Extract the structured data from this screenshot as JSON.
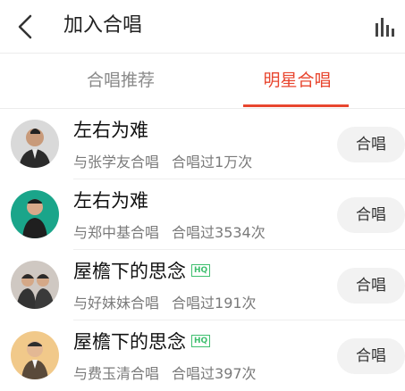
{
  "header": {
    "title": "加入合唱",
    "back_icon": "chevron-left-icon",
    "chart_icon": "bar-chart-icon"
  },
  "tabs": [
    {
      "label": "合唱推荐",
      "active": false
    },
    {
      "label": "明星合唱",
      "active": true
    }
  ],
  "accent_color": "#e8462f",
  "items": [
    {
      "title": "左右为难",
      "hq": false,
      "partner": "与张学友合唱",
      "count": "合唱过1万次",
      "button": "合唱",
      "avatar_bg": "#d9d9d9"
    },
    {
      "title": "左右为难",
      "hq": false,
      "partner": "与郑中基合唱",
      "count": "合唱过3534次",
      "button": "合唱",
      "avatar_bg": "#1aa58a"
    },
    {
      "title": "屋檐下的思念",
      "hq": true,
      "hq_label": "HQ",
      "partner": "与好妹妹合唱",
      "count": "合唱过191次",
      "button": "合唱",
      "avatar_bg": "#cfc8c2"
    },
    {
      "title": "屋檐下的思念",
      "hq": true,
      "hq_label": "HQ",
      "partner": "与费玉清合唱",
      "count": "合唱过397次",
      "button": "合唱",
      "avatar_bg": "#f1c98a"
    }
  ]
}
